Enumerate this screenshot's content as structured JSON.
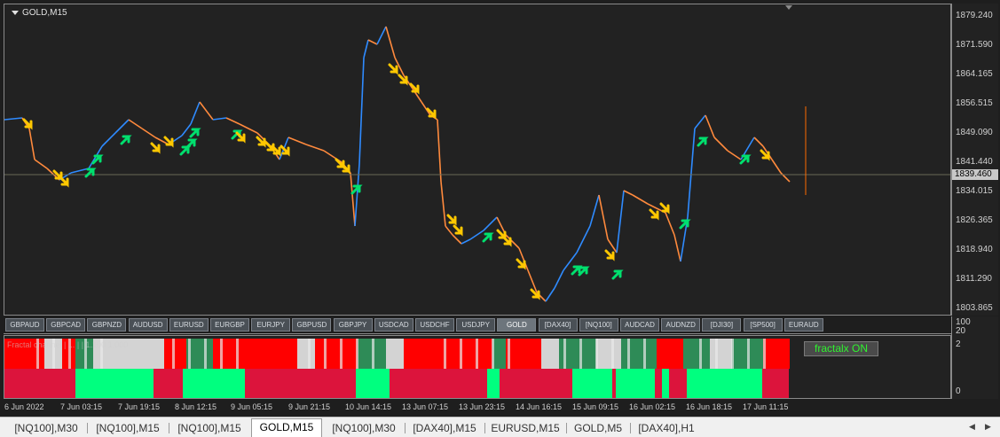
{
  "chart": {
    "title": "GOLD,M15",
    "current_price": "1839.460",
    "price_axis": [
      "1879.240",
      "1871.590",
      "1864.165",
      "1856.515",
      "1849.090",
      "1841.440",
      "1834.015",
      "1826.365",
      "1818.940",
      "1811.290",
      "1803.865"
    ],
    "symbols": [
      "GBPAUD",
      "GBPCAD",
      "GBPNZD",
      "AUDUSD",
      "EURUSD",
      "EURGBP",
      "EURJPY",
      "GBPUSD",
      "GBPJPY",
      "USDCAD",
      "USDCHF",
      "USDJPY",
      "GOLD",
      "[DAX40]",
      "[NQ100]",
      "AUDCAD",
      "AUDNZD",
      "[DJI30]",
      "[SP500]",
      "EURAUD"
    ],
    "active_symbol": "GOLD",
    "time_axis": [
      "6 Jun 2022",
      "7 Jun 03:15",
      "7 Jun 19:15",
      "8 Jun 12:15",
      "9 Jun 05:15",
      "9 Jun 21:15",
      "10 Jun 14:15",
      "13 Jun 07:15",
      "13 Jun 23:15",
      "14 Jun 16:15",
      "15 Jun 09:15",
      "16 Jun 02:15",
      "16 Jun 18:15",
      "17 Jun 11:15"
    ]
  },
  "indicator": {
    "label": "Fractal channel | ... | | 1.100 1.000",
    "axis_top": "100",
    "axis_top2": "20",
    "axis_mid": "2",
    "axis_bottom": "0",
    "badge": "fractalx ON",
    "colors": {
      "red": "#ff0000",
      "gray": "#d3d3d3",
      "darkgreen": "#2e8b57",
      "green": "#00ff7f",
      "crimson": "#dc143c"
    }
  },
  "tabs": [
    "[NQ100],M30",
    "[NQ100],M15",
    "[NQ100],M15",
    "GOLD,M15",
    "[NQ100],M30",
    "[DAX40],M15",
    "EURUSD,M15",
    "GOLD,M5",
    "[DAX40],H1"
  ],
  "active_tab": 3
}
